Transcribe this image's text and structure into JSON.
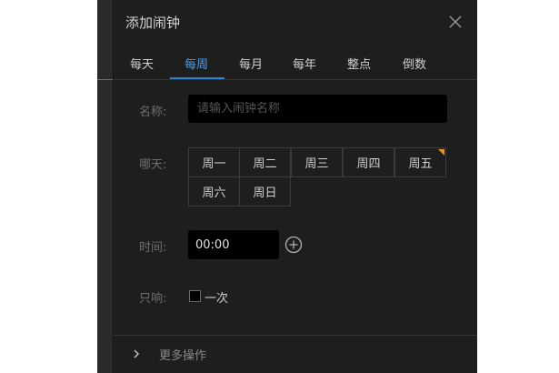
{
  "dialog": {
    "title": "添加闹钟"
  },
  "tabs": [
    {
      "label": "每天",
      "active": false
    },
    {
      "label": "每周",
      "active": true
    },
    {
      "label": "每月",
      "active": false
    },
    {
      "label": "每年",
      "active": false
    },
    {
      "label": "整点",
      "active": false
    },
    {
      "label": "倒数",
      "active": false
    }
  ],
  "form": {
    "name_label": "名称:",
    "name_value": "",
    "name_placeholder": "请输入闹钟名称",
    "days_label": "哪天:",
    "days": [
      {
        "label": "周一",
        "selected": false
      },
      {
        "label": "周二",
        "selected": false
      },
      {
        "label": "周三",
        "selected": false
      },
      {
        "label": "周四",
        "selected": false
      },
      {
        "label": "周五",
        "selected": true
      },
      {
        "label": "周六",
        "selected": false
      },
      {
        "label": "周日",
        "selected": false
      }
    ],
    "time_label": "时间:",
    "time_value": "00:00",
    "once_label": "只响:",
    "once_option": "一次",
    "once_checked": false
  },
  "footer": {
    "more_label": "更多操作"
  },
  "icons": {
    "close": "close-icon",
    "add": "plus-circle-icon",
    "expand": "chevron-right-icon"
  },
  "colors": {
    "accent": "#2f7fd4",
    "selected_corner": "#e8922b",
    "dialog_bg": "#1e1e1e"
  }
}
